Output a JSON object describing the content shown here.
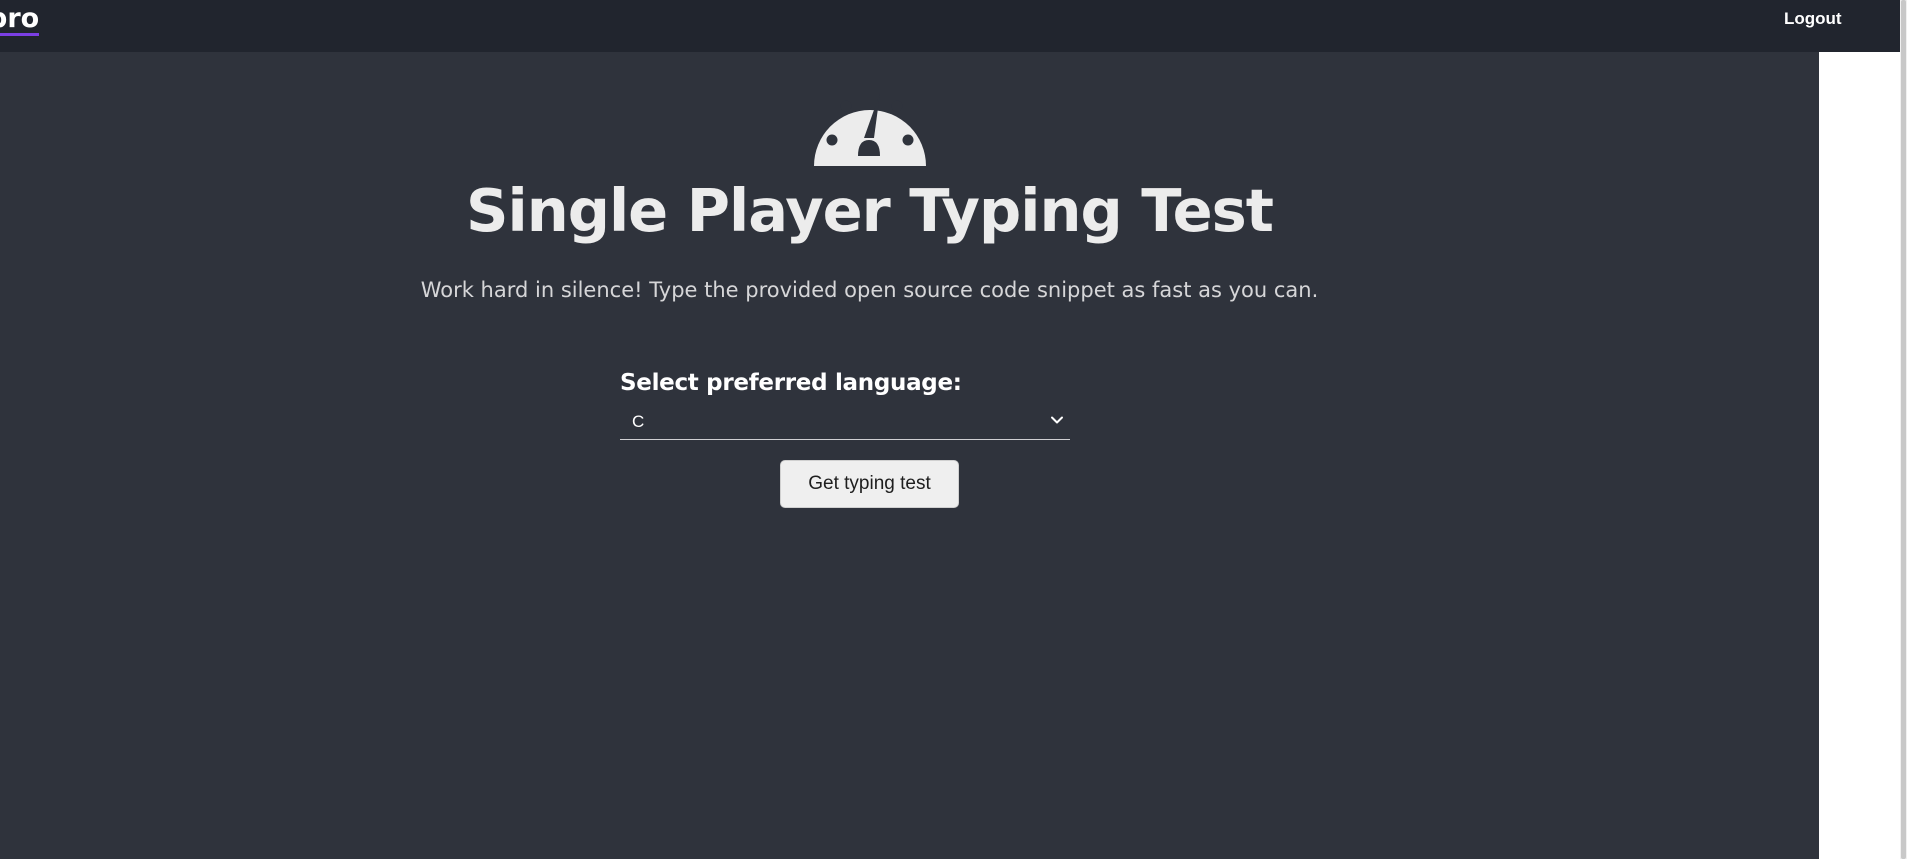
{
  "navbar": {
    "brand_text": "pro",
    "logout_label": "Logout"
  },
  "hero": {
    "icon": "tachometer-icon",
    "title": "Single Player Typing Test",
    "subtitle": "Work hard in silence! Type the provided open source code snippet as fast as you can."
  },
  "form": {
    "language_label": "Select preferred language:",
    "language_selected": "C",
    "submit_label": "Get typing test"
  },
  "colors": {
    "navbar_bg": "#21252e",
    "main_bg": "#2f333c",
    "brand_underline": "#7b3fe4",
    "text_primary": "#ececec",
    "button_bg": "#efefef"
  }
}
